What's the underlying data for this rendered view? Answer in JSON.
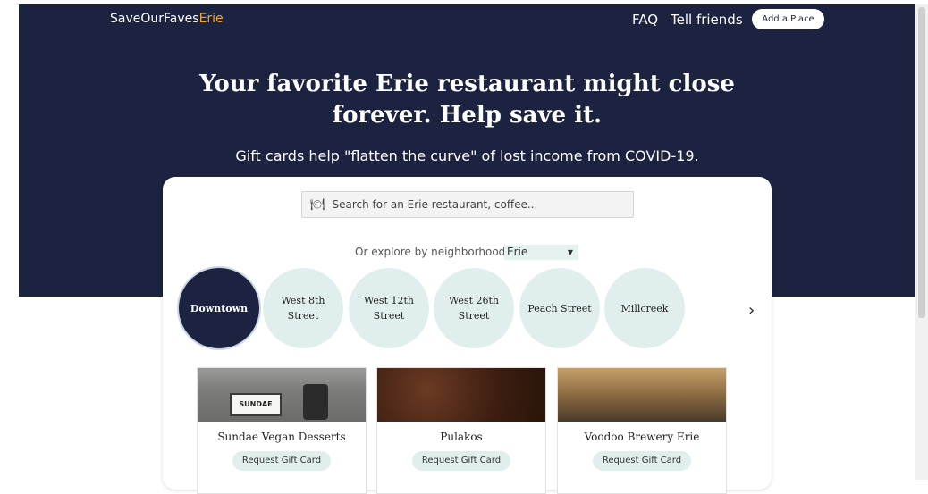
{
  "header": {
    "brand_main": "SaveOurFaves",
    "brand_accent": "Erie",
    "nav": [
      "FAQ",
      "Tell friends"
    ],
    "add_place": "Add a Place"
  },
  "hero": {
    "headline_line1": "Your favorite Erie restaurant might close",
    "headline_line2": "forever. Help save it.",
    "subhead": "Gift cards help \"flatten the curve\" of lost income from COVID-19."
  },
  "search": {
    "icon": "plate-icon",
    "placeholder": "Search for an Erie restaurant, coffee..."
  },
  "explore": {
    "label": "Or explore by neighborhood in",
    "city": "Erie"
  },
  "neighborhoods": [
    {
      "label": "Downtown",
      "active": true
    },
    {
      "label": "West 8th Street",
      "active": false
    },
    {
      "label": "West 12th Street",
      "active": false
    },
    {
      "label": "West 26th Street",
      "active": false
    },
    {
      "label": "Peach Street",
      "active": false
    },
    {
      "label": "Millcreek",
      "active": false
    }
  ],
  "places": [
    {
      "name": "Sundae Vegan Desserts",
      "button": "Request Gift Card",
      "sign_text": "SUNDAE"
    },
    {
      "name": "Pulakos",
      "button": "Request Gift Card"
    },
    {
      "name": "Voodoo Brewery Erie",
      "button": "Request Gift Card"
    }
  ],
  "colors": {
    "hero_bg": "#1c2340",
    "accent": "#f5a623",
    "pill_bg": "#e0efee"
  }
}
